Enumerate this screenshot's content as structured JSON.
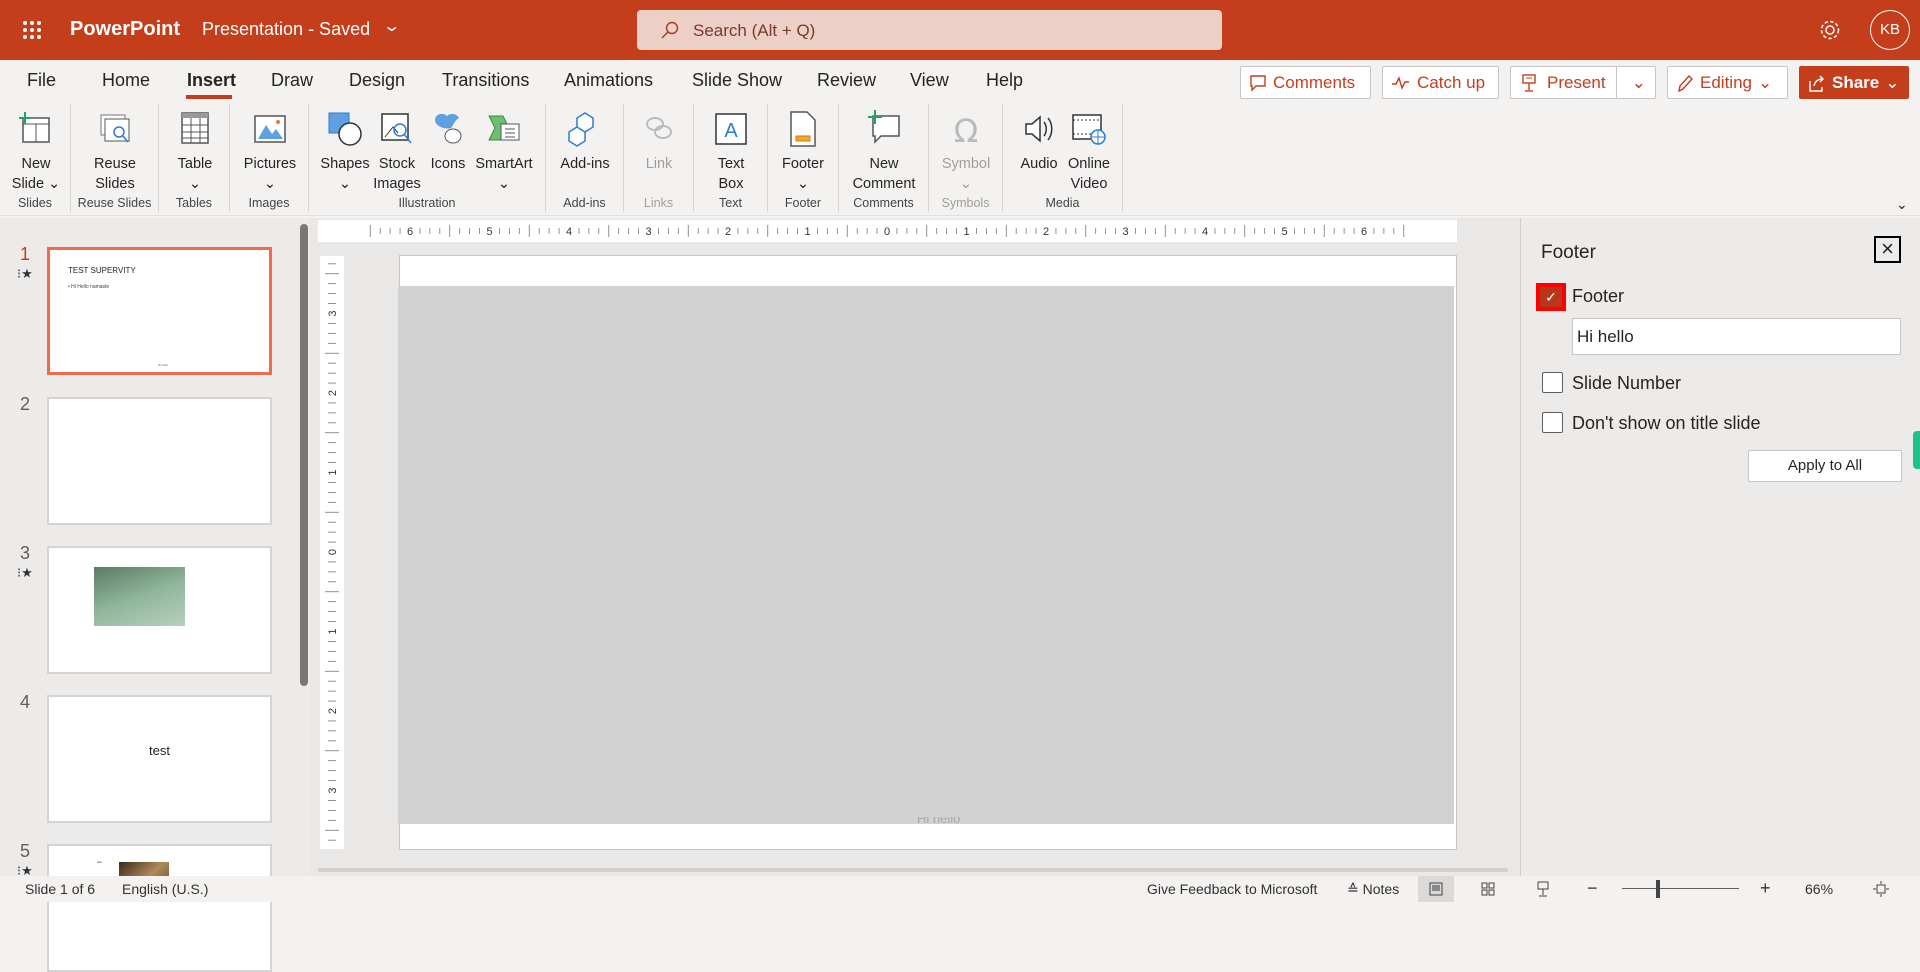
{
  "titlebar": {
    "app_name": "PowerPoint",
    "doc_title": "Presentation - Saved",
    "search_placeholder": "Search (Alt + Q)",
    "avatar_initials": "KB",
    "brand_color": "#c43e1c"
  },
  "tabs": [
    {
      "label": "File"
    },
    {
      "label": "Home"
    },
    {
      "label": "Insert",
      "active": true
    },
    {
      "label": "Draw"
    },
    {
      "label": "Design"
    },
    {
      "label": "Transitions"
    },
    {
      "label": "Animations"
    },
    {
      "label": "Slide Show"
    },
    {
      "label": "Review"
    },
    {
      "label": "View"
    },
    {
      "label": "Help"
    }
  ],
  "actions": {
    "comments": "Comments",
    "catch_up": "Catch up",
    "present": "Present",
    "editing": "Editing",
    "share": "Share"
  },
  "ribbon": [
    {
      "label": "Slides",
      "items": [
        {
          "lines": [
            "New",
            "Slide ⌄"
          ],
          "icon": "new-slide"
        }
      ]
    },
    {
      "label": "Reuse Slides",
      "items": [
        {
          "lines": [
            "Reuse",
            "Slides"
          ],
          "icon": "reuse-slides"
        }
      ]
    },
    {
      "label": "Tables",
      "items": [
        {
          "lines": [
            "Table",
            "⌄"
          ],
          "icon": "table"
        }
      ]
    },
    {
      "label": "Images",
      "items": [
        {
          "lines": [
            "Pictures",
            "⌄"
          ],
          "icon": "pictures"
        }
      ]
    },
    {
      "label": "Illustration",
      "items": [
        {
          "lines": [
            "Shapes",
            "⌄"
          ],
          "icon": "shapes"
        },
        {
          "lines": [
            "Stock",
            "Images"
          ],
          "icon": "stock-images"
        },
        {
          "lines": [
            "Icons"
          ],
          "icon": "icons"
        },
        {
          "lines": [
            "SmartArt",
            "⌄"
          ],
          "icon": "smartart"
        }
      ]
    },
    {
      "label": "Add-ins",
      "items": [
        {
          "lines": [
            "Add-ins"
          ],
          "icon": "add-ins"
        }
      ]
    },
    {
      "label": "Links",
      "disabled": true,
      "items": [
        {
          "lines": [
            "Link"
          ],
          "icon": "link",
          "disabled": true
        }
      ]
    },
    {
      "label": "Text",
      "items": [
        {
          "lines": [
            "Text",
            "Box"
          ],
          "icon": "text-box"
        }
      ]
    },
    {
      "label": "Footer",
      "items": [
        {
          "lines": [
            "Footer",
            "⌄"
          ],
          "icon": "footer"
        }
      ]
    },
    {
      "label": "Comments",
      "items": [
        {
          "lines": [
            "New",
            "Comment"
          ],
          "icon": "new-comment"
        }
      ]
    },
    {
      "label": "Symbols",
      "disabled": true,
      "items": [
        {
          "lines": [
            "Symbol",
            "⌄"
          ],
          "icon": "symbol",
          "disabled": true
        }
      ]
    },
    {
      "label": "Media",
      "items": [
        {
          "lines": [
            "Audio"
          ],
          "icon": "audio"
        },
        {
          "lines": [
            "Online",
            "Video"
          ],
          "icon": "online-video"
        }
      ]
    }
  ],
  "slides": [
    {
      "number": "1",
      "title": "TEST SUPERVITY",
      "bullet": "• Hi Hello namaste",
      "footer": "Hi hello",
      "animated": true,
      "selected": true
    },
    {
      "number": "2"
    },
    {
      "number": "3",
      "animated": true,
      "image": "people"
    },
    {
      "number": "4",
      "text": "test"
    },
    {
      "number": "5",
      "animated": true,
      "small_text": "test",
      "image": "food"
    }
  ],
  "ruler": {
    "horizontal": [
      "6",
      "5",
      "4",
      "3",
      "2",
      "1",
      "0",
      "1",
      "2",
      "3",
      "4",
      "5",
      "6"
    ],
    "vertical": [
      "3",
      "2",
      "1",
      "0",
      "1",
      "2",
      "3"
    ]
  },
  "canvas": {
    "footer_text": "Hi hello"
  },
  "footer_pane": {
    "title": "Footer",
    "footer_label": "Footer",
    "footer_checked": true,
    "footer_value": "Hi hello",
    "slide_number_label": "Slide Number",
    "slide_number_checked": false,
    "dont_show_label": "Don't show on title slide",
    "dont_show_checked": false,
    "apply_all": "Apply to All"
  },
  "statusbar": {
    "slide_info": "Slide 1 of 6",
    "language": "English (U.S.)",
    "feedback": "Give Feedback to Microsoft",
    "notes": "Notes",
    "zoom": "66%",
    "zoom_percent": 66
  }
}
